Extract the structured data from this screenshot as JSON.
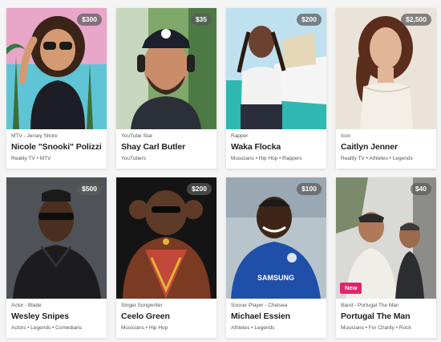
{
  "cards": [
    {
      "price": "$300",
      "category": "MTV - Jersey Shore",
      "name": "Nicole \"Snooki\" Polizzi",
      "tags": "Reality TV • MTV",
      "badge": ""
    },
    {
      "price": "$35",
      "category": "YouTube Star",
      "name": "Shay Carl Butler",
      "tags": "YouTubers",
      "badge": ""
    },
    {
      "price": "$200",
      "category": "Rapper",
      "name": "Waka Flocka",
      "tags": "Musicians • Hip Hop • Rappers",
      "badge": ""
    },
    {
      "price": "$2,500",
      "category": "Icon",
      "name": "Caitlyn Jenner",
      "tags": "Reality TV • Athletes • Legends",
      "badge": ""
    },
    {
      "price": "$500",
      "category": "Actor - Blade",
      "name": "Wesley Snipes",
      "tags": "Actors • Legends • Comedians",
      "badge": ""
    },
    {
      "price": "$200",
      "category": "Singer Songwriter",
      "name": "Ceelo Green",
      "tags": "Musicians • Hip Hop",
      "badge": ""
    },
    {
      "price": "$100",
      "category": "Soccer Player - Chelsea",
      "name": "Michael Essien",
      "tags": "Athletes • Legends",
      "badge": ""
    },
    {
      "price": "$40",
      "category": "Band - Portugal The Man",
      "name": "Portugal The Man",
      "tags": "Musicians • For Charity • Rock",
      "badge": "New"
    }
  ],
  "colors": {
    "accent_badge": "#e2256a",
    "price_pill": "#5a5a5a",
    "page_bg": "#f4f4f4"
  }
}
